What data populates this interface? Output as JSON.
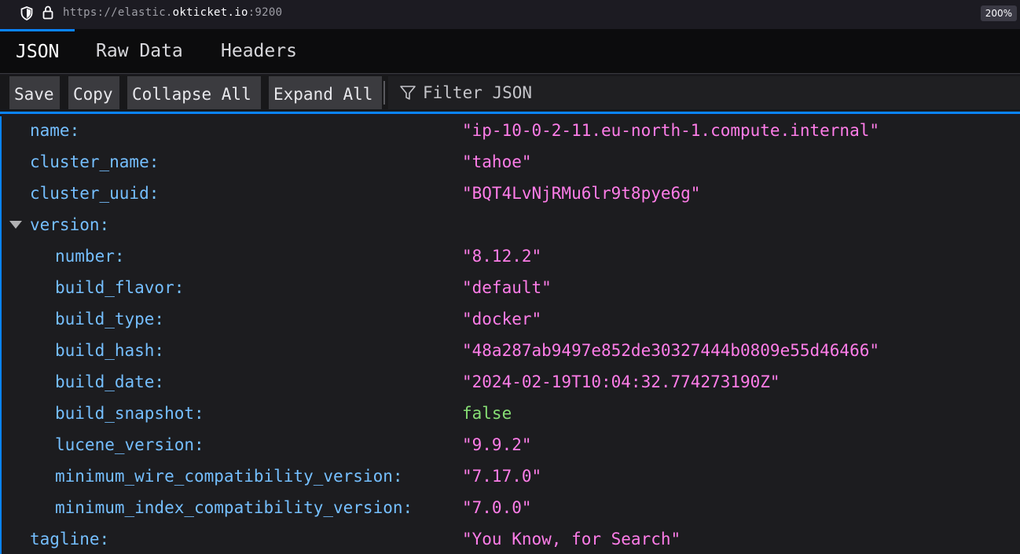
{
  "browser": {
    "url_prefix": "https://elastic.",
    "url_host": "okticket.io",
    "url_suffix": ":9200",
    "zoom": "200%"
  },
  "tabs": [
    {
      "label": "JSON",
      "active": true
    },
    {
      "label": "Raw Data",
      "active": false
    },
    {
      "label": "Headers",
      "active": false
    }
  ],
  "toolbar": {
    "save": "Save",
    "copy": "Copy",
    "collapse_all": "Collapse All",
    "expand_all": "Expand All",
    "filter_placeholder": "Filter JSON"
  },
  "json": {
    "name_key": "name:",
    "name_val": "\"ip-10-0-2-11.eu-north-1.compute.internal\"",
    "cluster_name_key": "cluster_name:",
    "cluster_name_val": "\"tahoe\"",
    "cluster_uuid_key": "cluster_uuid:",
    "cluster_uuid_val": "\"BQT4LvNjRMu6lr9t8pye6g\"",
    "version_key": "version:",
    "number_key": "number:",
    "number_val": "\"8.12.2\"",
    "build_flavor_key": "build_flavor:",
    "build_flavor_val": "\"default\"",
    "build_type_key": "build_type:",
    "build_type_val": "\"docker\"",
    "build_hash_key": "build_hash:",
    "build_hash_val": "\"48a287ab9497e852de30327444b0809e55d46466\"",
    "build_date_key": "build_date:",
    "build_date_val": "\"2024-02-19T10:04:32.774273190Z\"",
    "build_snapshot_key": "build_snapshot:",
    "build_snapshot_val": "false",
    "lucene_version_key": "lucene_version:",
    "lucene_version_val": "\"9.9.2\"",
    "min_wire_key": "minimum_wire_compatibility_version:",
    "min_wire_val": "\"7.17.0\"",
    "min_index_key": "minimum_index_compatibility_version:",
    "min_index_val": "\"7.0.0\"",
    "tagline_key": "tagline:",
    "tagline_val": "\"You Know, for Search\""
  },
  "colors": {
    "key": "#75bfff",
    "string": "#ff7de9",
    "boolean": "#86de74",
    "accent": "#0a84ff"
  }
}
